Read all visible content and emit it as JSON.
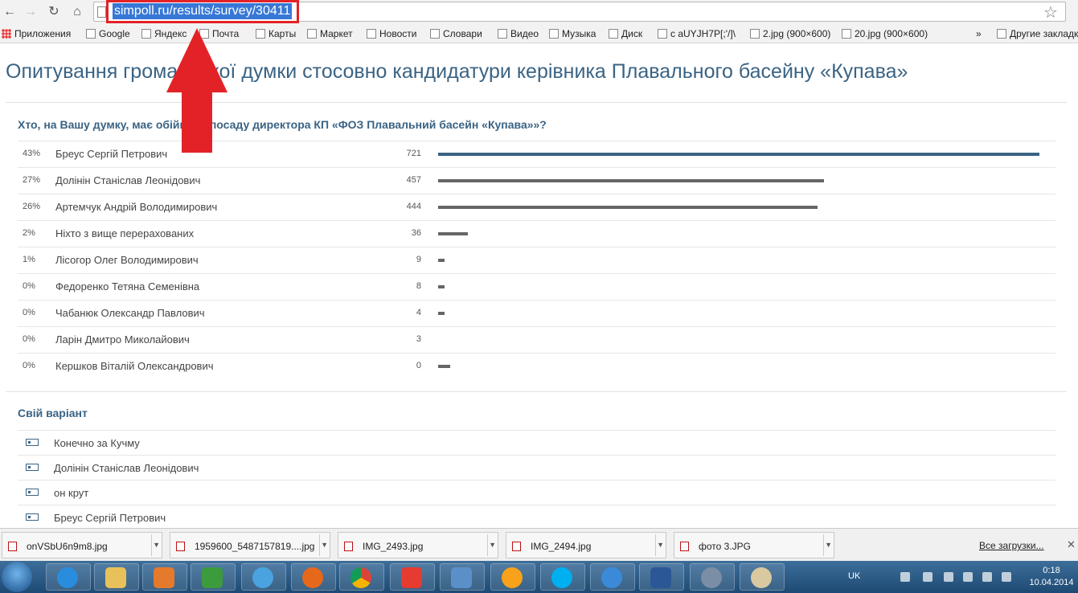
{
  "browser": {
    "url": "simpoll.ru/results/survey/30411",
    "bookmarks": [
      {
        "label": "Приложения",
        "icon": "apps-icon"
      },
      {
        "label": "Google",
        "icon": "google-icon"
      },
      {
        "label": "Яндекс",
        "icon": "yandex-icon"
      },
      {
        "label": "Почта",
        "icon": "mail-icon"
      },
      {
        "label": "Карты",
        "icon": "page-icon"
      },
      {
        "label": "Маркет",
        "icon": "market-icon"
      },
      {
        "label": "Новости",
        "icon": "news-icon"
      },
      {
        "label": "Словари",
        "icon": "dictionary-icon"
      },
      {
        "label": "Видео",
        "icon": "page-icon"
      },
      {
        "label": "Музыка",
        "icon": "music-icon"
      },
      {
        "label": "Диск",
        "icon": "disk-icon"
      },
      {
        "label": "с aUYJH7P[;'/]\\",
        "icon": "facebook-icon"
      },
      {
        "label": "2.jpg (900×600)",
        "icon": "page-icon"
      },
      {
        "label": "20.jpg (900×600)",
        "icon": "page-icon"
      },
      {
        "label": "»",
        "icon": ""
      },
      {
        "label": "Другие закладки",
        "icon": "folder-icon"
      }
    ]
  },
  "page": {
    "title": "Опитування громадської думки стосовно кандидатури керівника Плавального басейну «Купава»",
    "question": "Хто, на Вашу думку, має обіймати посаду директора КП «ФОЗ Плавальний басейн «Купава»»?",
    "results": [
      {
        "pct": "43%",
        "name": "Бреус Сергій Петрович",
        "count": "721",
        "bar": 1.0
      },
      {
        "pct": "27%",
        "name": "Долінін Станіслав Леонідович",
        "count": "457",
        "bar": 0.642
      },
      {
        "pct": "26%",
        "name": "Артемчук Андрій Володимирович",
        "count": "444",
        "bar": 0.631
      },
      {
        "pct": "2%",
        "name": "Ніхто з вище перерахованих",
        "count": "36",
        "bar": 0.05
      },
      {
        "pct": "1%",
        "name": "Лісогор Олег Володимирович",
        "count": "9",
        "bar": 0.011
      },
      {
        "pct": "0%",
        "name": "Федоренко Тетяна Семенівна",
        "count": "8",
        "bar": 0.011
      },
      {
        "pct": "0%",
        "name": "Чабанюк Олександр Павлович",
        "count": "4",
        "bar": 0.011
      },
      {
        "pct": "0%",
        "name": "Ларін Дмитро Миколайович",
        "count": "3",
        "bar": 0
      },
      {
        "pct": "0%",
        "name": "Кершков Віталій Олександрович",
        "count": "0",
        "bar": 0.02
      }
    ],
    "own_variant_title": "Свій варіант",
    "own_variants": [
      "Конечно за Кучму",
      "Долінін Станіслав Леонідович",
      "он крут",
      "Бреус Сергій Петрович"
    ]
  },
  "downloads": {
    "items": [
      "onVSbU6n9m8.jpg",
      "1959600_5487157819....jpg",
      "IMG_2493.jpg",
      "IMG_2494.jpg",
      "фото 3.JPG"
    ],
    "show_all": "Все загрузки..."
  },
  "taskbar": {
    "lang": "UK",
    "time": "0:18",
    "date": "10.04.2014"
  },
  "colors": {
    "accent": "#3a6384",
    "bar": "#666666",
    "highlight": "#e32227"
  }
}
